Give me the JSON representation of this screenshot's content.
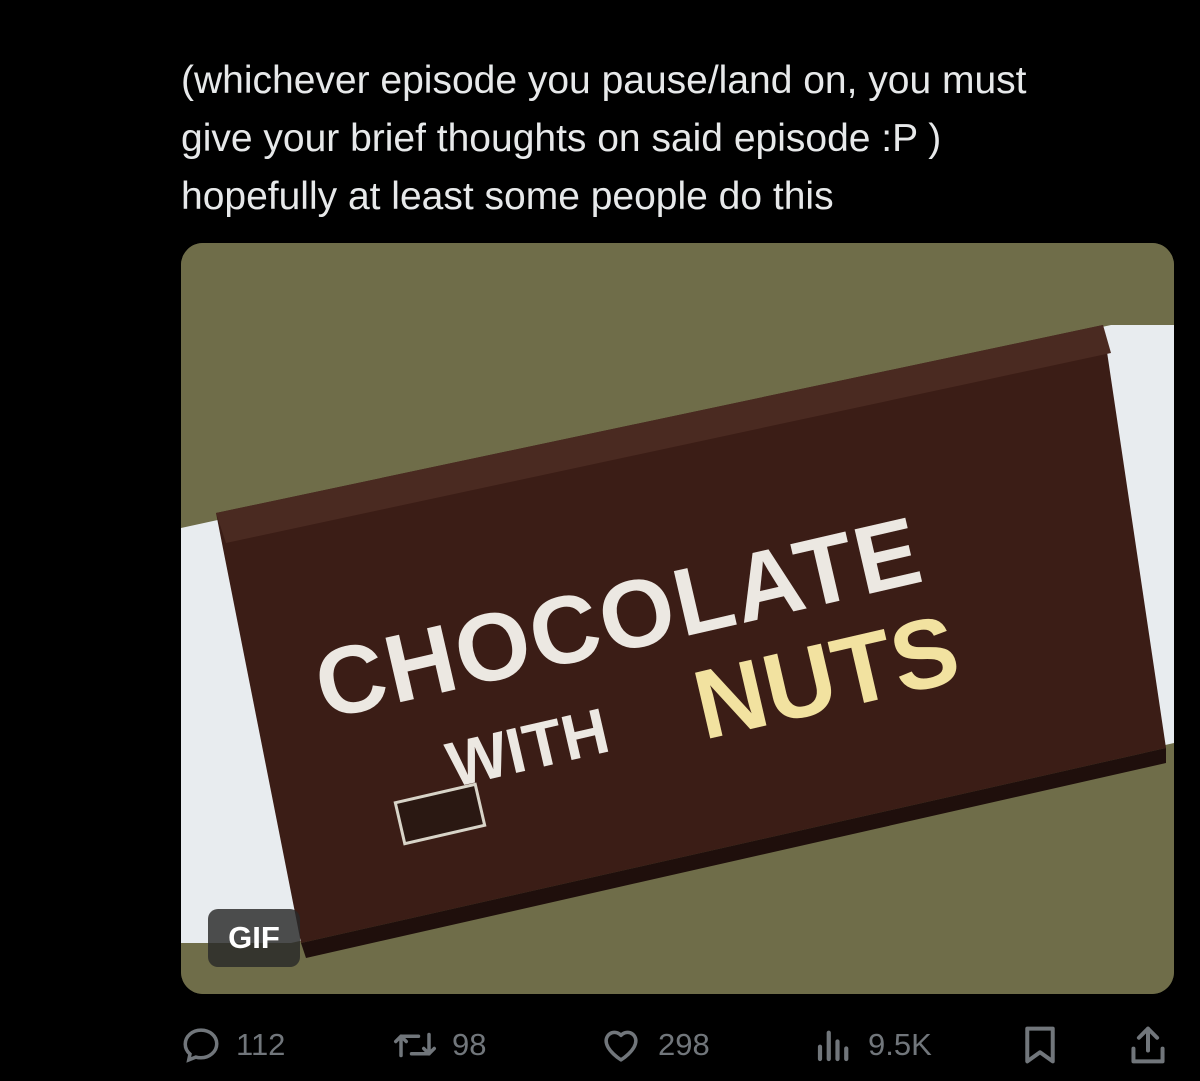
{
  "tweet": {
    "text_lines": [
      "(whichever episode you pause/land on, you must",
      "give your brief thoughts on said episode :P )",
      "hopefully at least some people do this"
    ]
  },
  "media": {
    "badge": "GIF",
    "image_text": {
      "line1": "CHOCOLATE",
      "line2_small": "WITH",
      "line2_large": "NUTS"
    },
    "colors": {
      "background": "#6f6d49",
      "wrapper": "#e8ecef",
      "bar": "#3b1d16",
      "title_text": "#ece8e2",
      "nuts_text": "#f2e2a0"
    }
  },
  "actions": {
    "reply": {
      "count": "112",
      "icon": "reply-icon"
    },
    "retweet": {
      "count": "98",
      "icon": "retweet-icon"
    },
    "like": {
      "count": "298",
      "icon": "heart-icon"
    },
    "views": {
      "count": "9.5K",
      "icon": "views-bar-chart-icon"
    },
    "bookmark": {
      "icon": "bookmark-icon"
    },
    "share": {
      "icon": "share-icon"
    }
  },
  "colors": {
    "page_background": "#000000",
    "text": "#e7e9ea",
    "muted": "#71767b"
  }
}
